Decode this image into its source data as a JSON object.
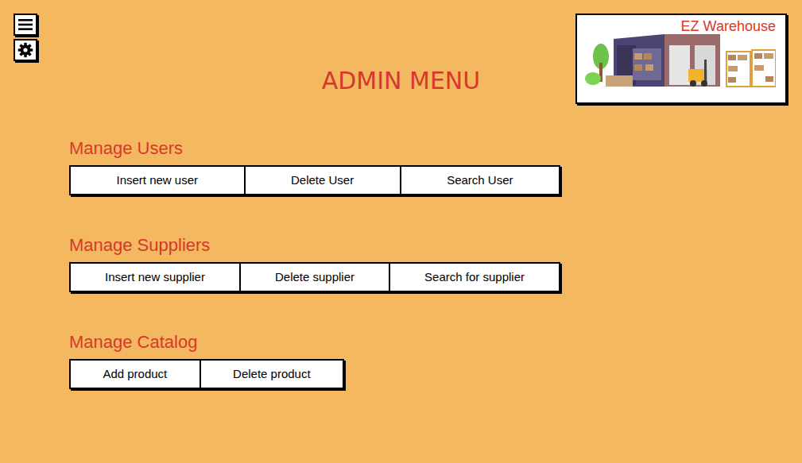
{
  "header": {
    "title": "ADMIN MENU",
    "logo": "EZ Warehouse"
  },
  "sections": [
    {
      "title": "Manage Users",
      "buttons": [
        "Insert new user",
        "Delete User",
        "Search User"
      ]
    },
    {
      "title": "Manage Suppliers",
      "buttons": [
        "Insert new supplier",
        "Delete supplier",
        "Search for supplier"
      ]
    },
    {
      "title": "Manage Catalog",
      "buttons": [
        "Add product",
        "Delete product"
      ]
    }
  ]
}
